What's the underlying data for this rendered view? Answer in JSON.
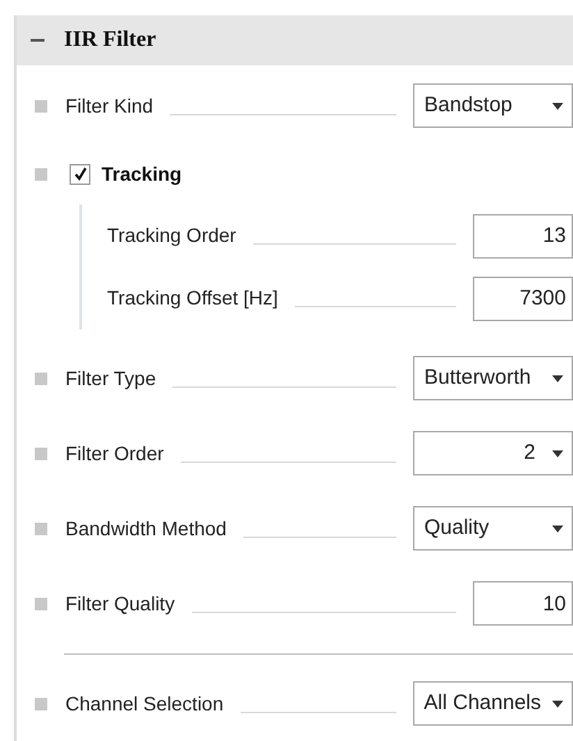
{
  "panel": {
    "title": "IIR Filter",
    "expanded": true
  },
  "properties": [
    {
      "kind": "dropdown",
      "label": "Filter Kind",
      "value": "Bandstop"
    },
    {
      "kind": "checkbox",
      "label": "Tracking",
      "checked": true,
      "children": [
        {
          "kind": "input",
          "label": "Tracking Order",
          "value": "13"
        },
        {
          "kind": "input",
          "label": "Tracking Offset [Hz]",
          "value": "7300"
        }
      ]
    },
    {
      "kind": "dropdown",
      "label": "Filter Type",
      "value": "Butterworth"
    },
    {
      "kind": "numeric-dropdown",
      "label": "Filter Order",
      "value": "2"
    },
    {
      "kind": "dropdown",
      "label": "Bandwidth Method",
      "value": "Quality"
    },
    {
      "kind": "input",
      "label": "Filter Quality",
      "value": "10"
    },
    {
      "kind": "separator"
    },
    {
      "kind": "dropdown",
      "label": "Channel Selection",
      "value": "All Channels"
    }
  ]
}
